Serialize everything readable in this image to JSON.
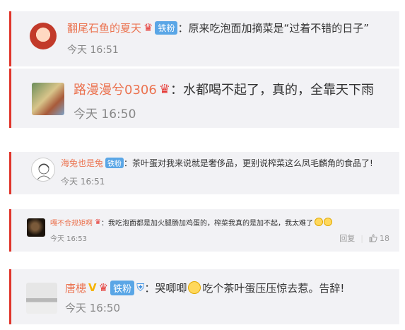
{
  "comments": [
    {
      "username": "翻尾石鱼的夏天",
      "badges": {
        "crown": "♛",
        "fan": "铁粉"
      },
      "colon": "：",
      "text": "原来吃泡面加摘菜是“过着不错的日子”",
      "time": "今天 16:51",
      "avatar_icon": "cartoon-boy-avatar"
    },
    {
      "username": "路漫漫兮0306",
      "badges": {
        "crown": "♛"
      },
      "colon": "：",
      "text": "水都喝不起了，真的，全靠天下雨",
      "time": "今天 16:50",
      "avatar_icon": "flower-photo-avatar"
    },
    {
      "username": "海兔也是兔",
      "badges": {
        "fan": "铁粉"
      },
      "colon": "：",
      "text": "茶叶蛋对我来说就是奢侈品，更别说榨菜这么凤毛麟角的食品了!",
      "time": "今天 16:51",
      "avatar_icon": "sketch-girl-avatar"
    },
    {
      "username": "嘎不合规矩啊",
      "badges": {
        "crown": "♛"
      },
      "colon": "：",
      "text": "我吃泡面都是加火腿肠加鸡蛋的，榨菜我真的是加不起，我太难了",
      "emoji_trailing": [
        "crying-emoji",
        "crying-emoji"
      ],
      "time": "今天 16:53",
      "reply_label": "回复",
      "like_count": "18"
    },
    {
      "username": "唐槵",
      "badges": {
        "v": "V",
        "crown": "♛",
        "fan": "铁粉",
        "shield": "⛨"
      },
      "colon": "：",
      "text_before_emoji": "哭唧唧",
      "emoji": "shy-emoji",
      "text_after_emoji": "吃个茶叶蛋压压惊去惹。告辞!",
      "time": "今天 16:50",
      "avatar_icon": "landscape-photo-avatar"
    }
  ],
  "colors": {
    "accent_bar": "#e0352b",
    "username": "#eb7350",
    "fan_badge": "#5aa6e6",
    "timestamp": "#888888",
    "card_bg": "#f2f2f5"
  }
}
